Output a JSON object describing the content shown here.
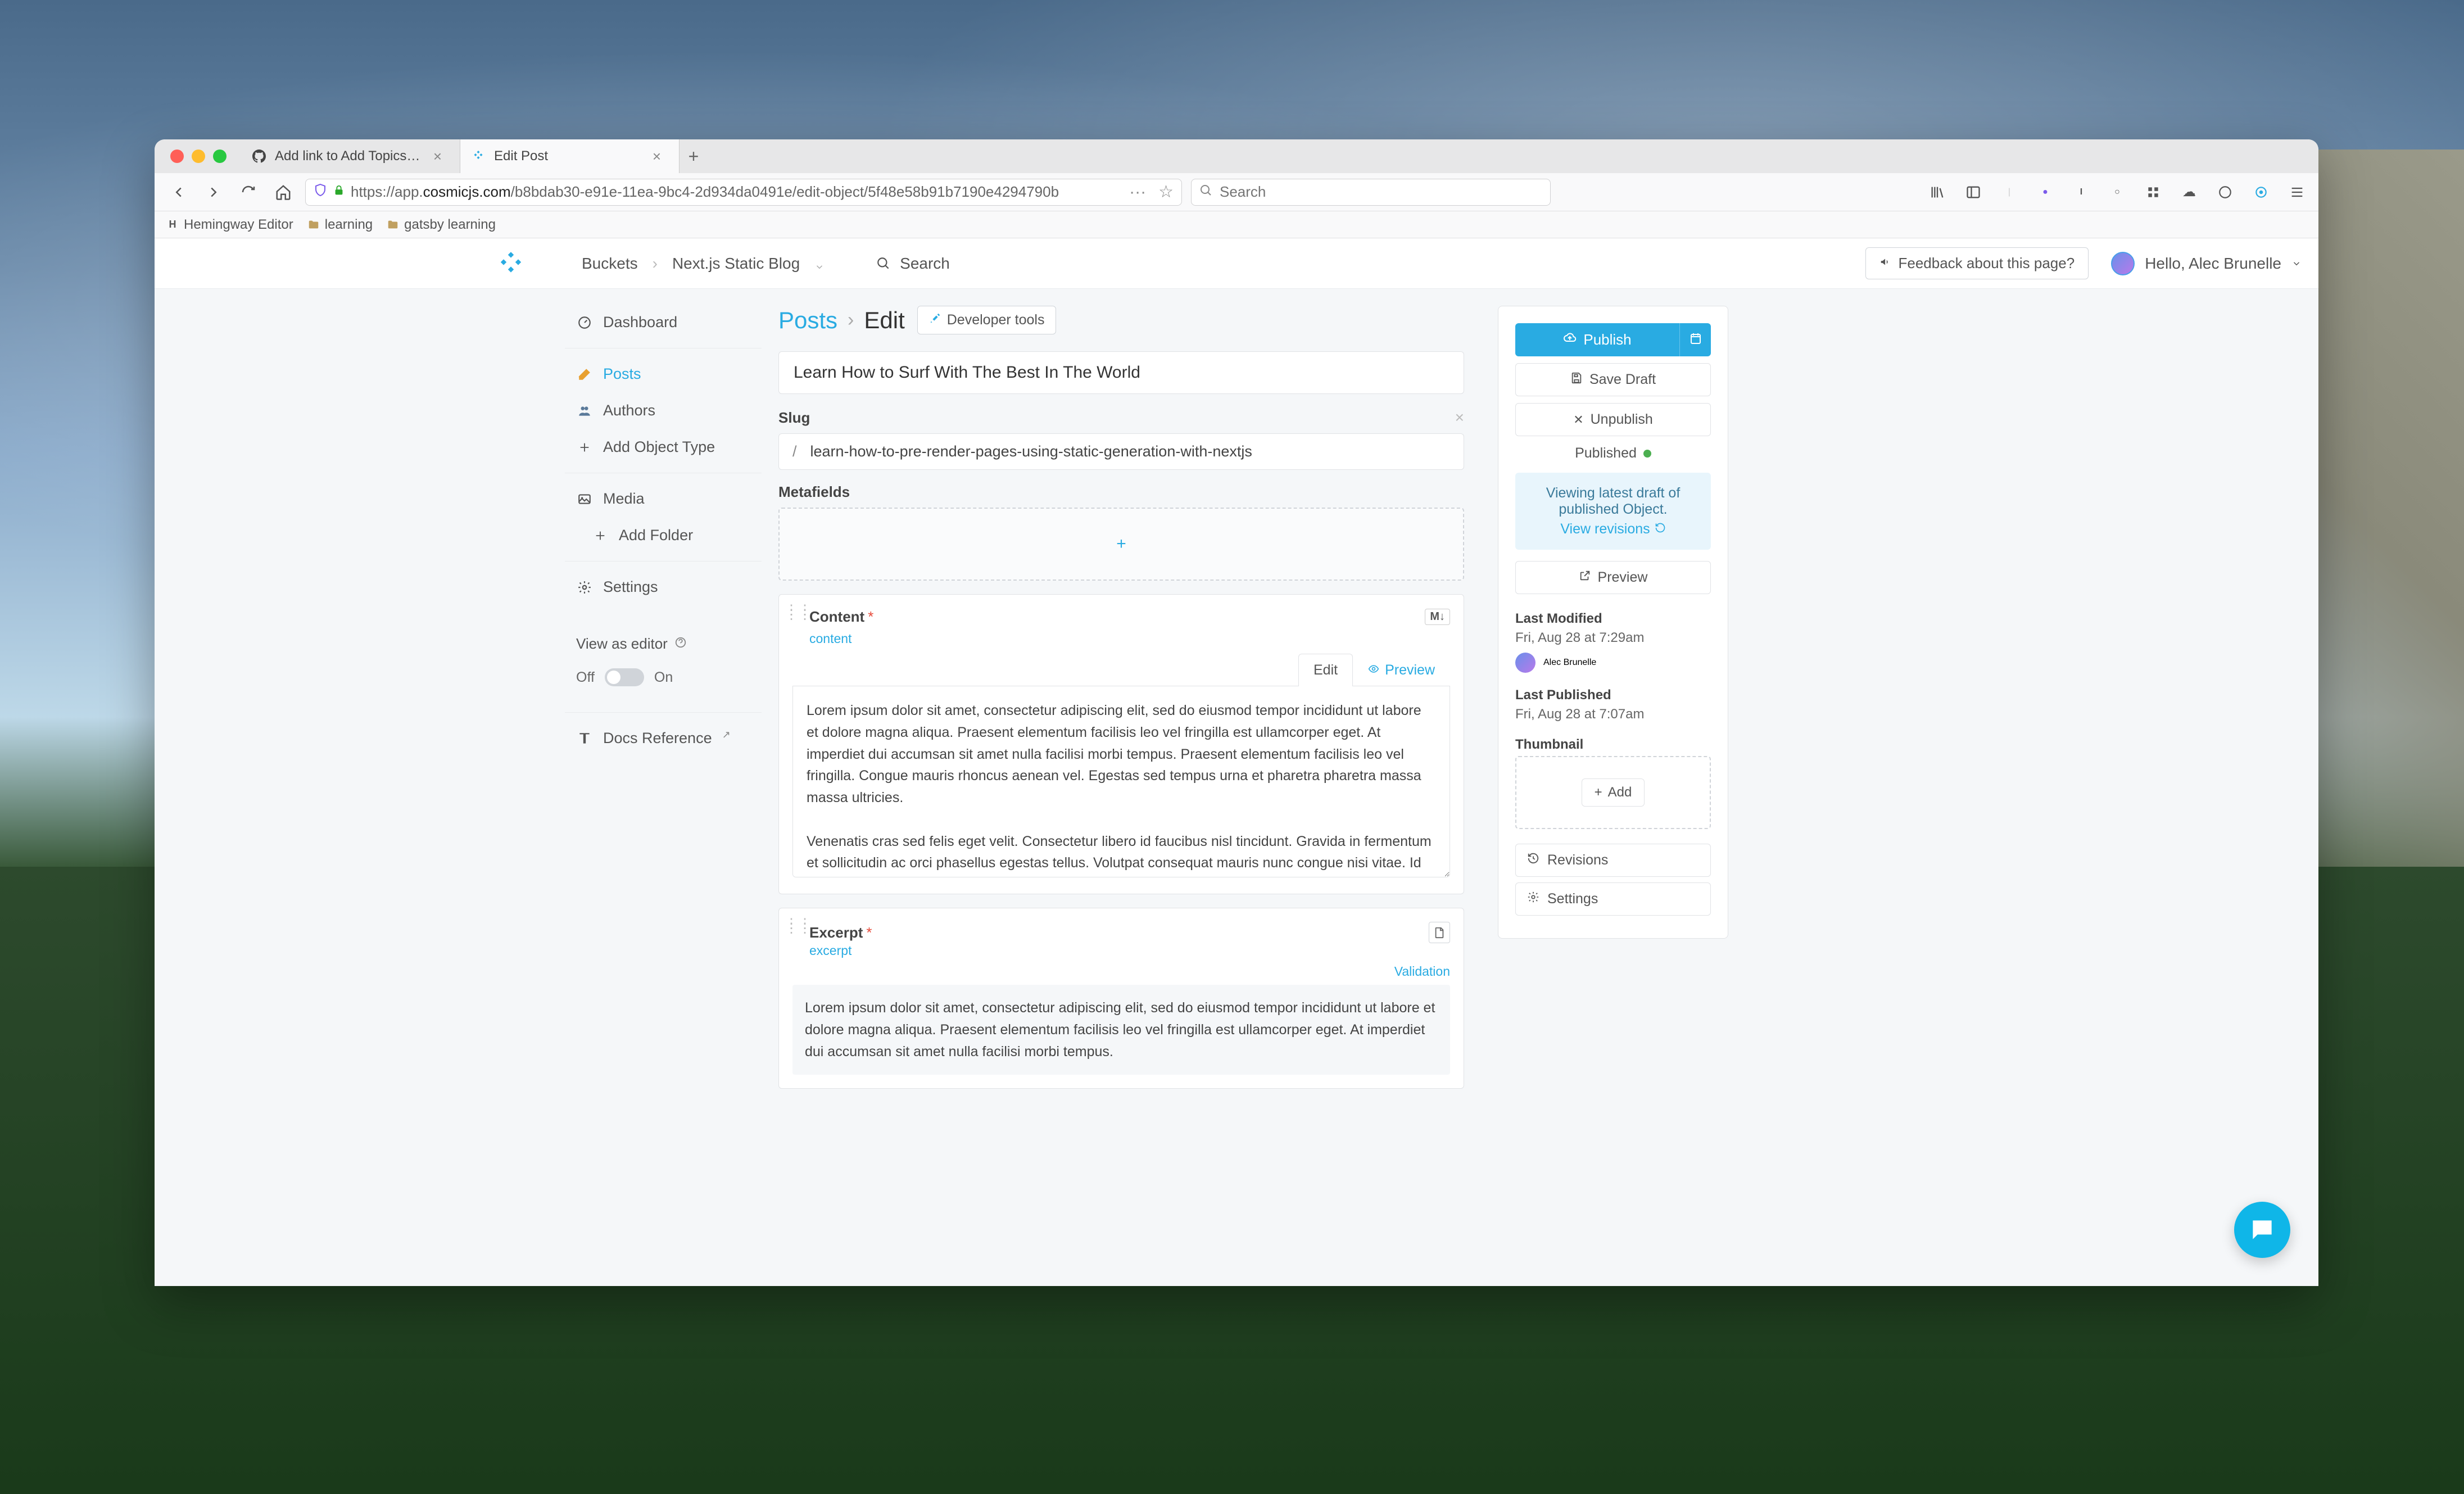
{
  "browser": {
    "tabs": [
      {
        "title": "Add link to Add Topics button s",
        "favicon": "github",
        "active": false
      },
      {
        "title": "Edit Post",
        "favicon": "cosmic",
        "active": true
      }
    ],
    "url_prefix": "https://app.",
    "url_bold": "cosmicjs.com",
    "url_suffix": "/b8bdab30-e91e-11ea-9bc4-2d934da0491e/edit-object/5f48e58b91b7190e4294790b",
    "search_placeholder": "Search",
    "bookmarks": [
      {
        "label": "Hemingway Editor",
        "icon": "H"
      },
      {
        "label": "learning",
        "icon": "folder"
      },
      {
        "label": "gatsby learning",
        "icon": "folder"
      }
    ]
  },
  "app_header": {
    "breadcrumbs": [
      "Buckets",
      "Next.js Static Blog"
    ],
    "search_label": "Search",
    "feedback_label": "Feedback about this page?",
    "greeting": "Hello, Alec Brunelle"
  },
  "sidebar": {
    "items": [
      {
        "label": "Dashboard",
        "icon": "dashboard"
      },
      {
        "label": "Posts",
        "icon": "posts",
        "active": true
      },
      {
        "label": "Authors",
        "icon": "authors"
      },
      {
        "label": "Add Object Type",
        "icon": "plus"
      },
      {
        "label": "Media",
        "icon": "media"
      },
      {
        "label": "Add Folder",
        "icon": "plus",
        "indent": true
      },
      {
        "label": "Settings",
        "icon": "gear"
      }
    ],
    "view_as_editor": "View as editor",
    "toggle_off": "Off",
    "toggle_on": "On",
    "docs_reference": "Docs Reference"
  },
  "page": {
    "breadcrumb_parent": "Posts",
    "breadcrumb_current": "Edit",
    "dev_tools": "Developer tools",
    "title": "Learn How to Surf With The Best In The World",
    "slug_label": "Slug",
    "slug_prefix": "/",
    "slug_value": "learn-how-to-pre-render-pages-using-static-generation-with-nextjs",
    "metafields_label": "Metafields",
    "metafields_add": "+"
  },
  "content_field": {
    "title": "Content",
    "key": "content",
    "markdown_badge": "M↓",
    "tab_edit": "Edit",
    "tab_preview": "Preview",
    "body": "Lorem ipsum dolor sit amet, consectetur adipiscing elit, sed do eiusmod tempor incididunt ut labore et dolore magna aliqua. Praesent elementum facilisis leo vel fringilla est ullamcorper eget. At imperdiet dui accumsan sit amet nulla facilisi morbi tempus. Praesent elementum facilisis leo vel fringilla. Congue mauris rhoncus aenean vel. Egestas sed tempus urna et pharetra pharetra massa massa ultricies.\n\nVenenatis cras sed felis eget velit. Consectetur libero id faucibus nisl tincidunt. Gravida in fermentum et sollicitudin ac orci phasellus egestas tellus. Volutpat consequat mauris nunc congue nisi vitae. Id aliquet risus feugiat in ante metus dictum at tempor."
  },
  "excerpt_field": {
    "title": "Excerpt",
    "key": "excerpt",
    "validation": "Validation",
    "body": "Lorem ipsum dolor sit amet, consectetur adipiscing elit, sed do eiusmod tempor incididunt ut labore et dolore magna aliqua. Praesent elementum facilisis leo vel fringilla est ullamcorper eget. At imperdiet dui accumsan sit amet nulla facilisi morbi tempus."
  },
  "right_panel": {
    "publish": "Publish",
    "save_draft": "Save Draft",
    "unpublish": "Unpublish",
    "status": "Published",
    "banner_line1": "Viewing latest draft of published Object.",
    "banner_link": "View revisions",
    "preview": "Preview",
    "last_modified_label": "Last Modified",
    "last_modified_date": "Fri, Aug 28 at 7:29am",
    "last_modified_user": "Alec Brunelle",
    "last_published_label": "Last Published",
    "last_published_date": "Fri, Aug 28 at 7:07am",
    "thumbnail_label": "Thumbnail",
    "add_thumb": "Add",
    "revisions": "Revisions",
    "settings": "Settings"
  }
}
